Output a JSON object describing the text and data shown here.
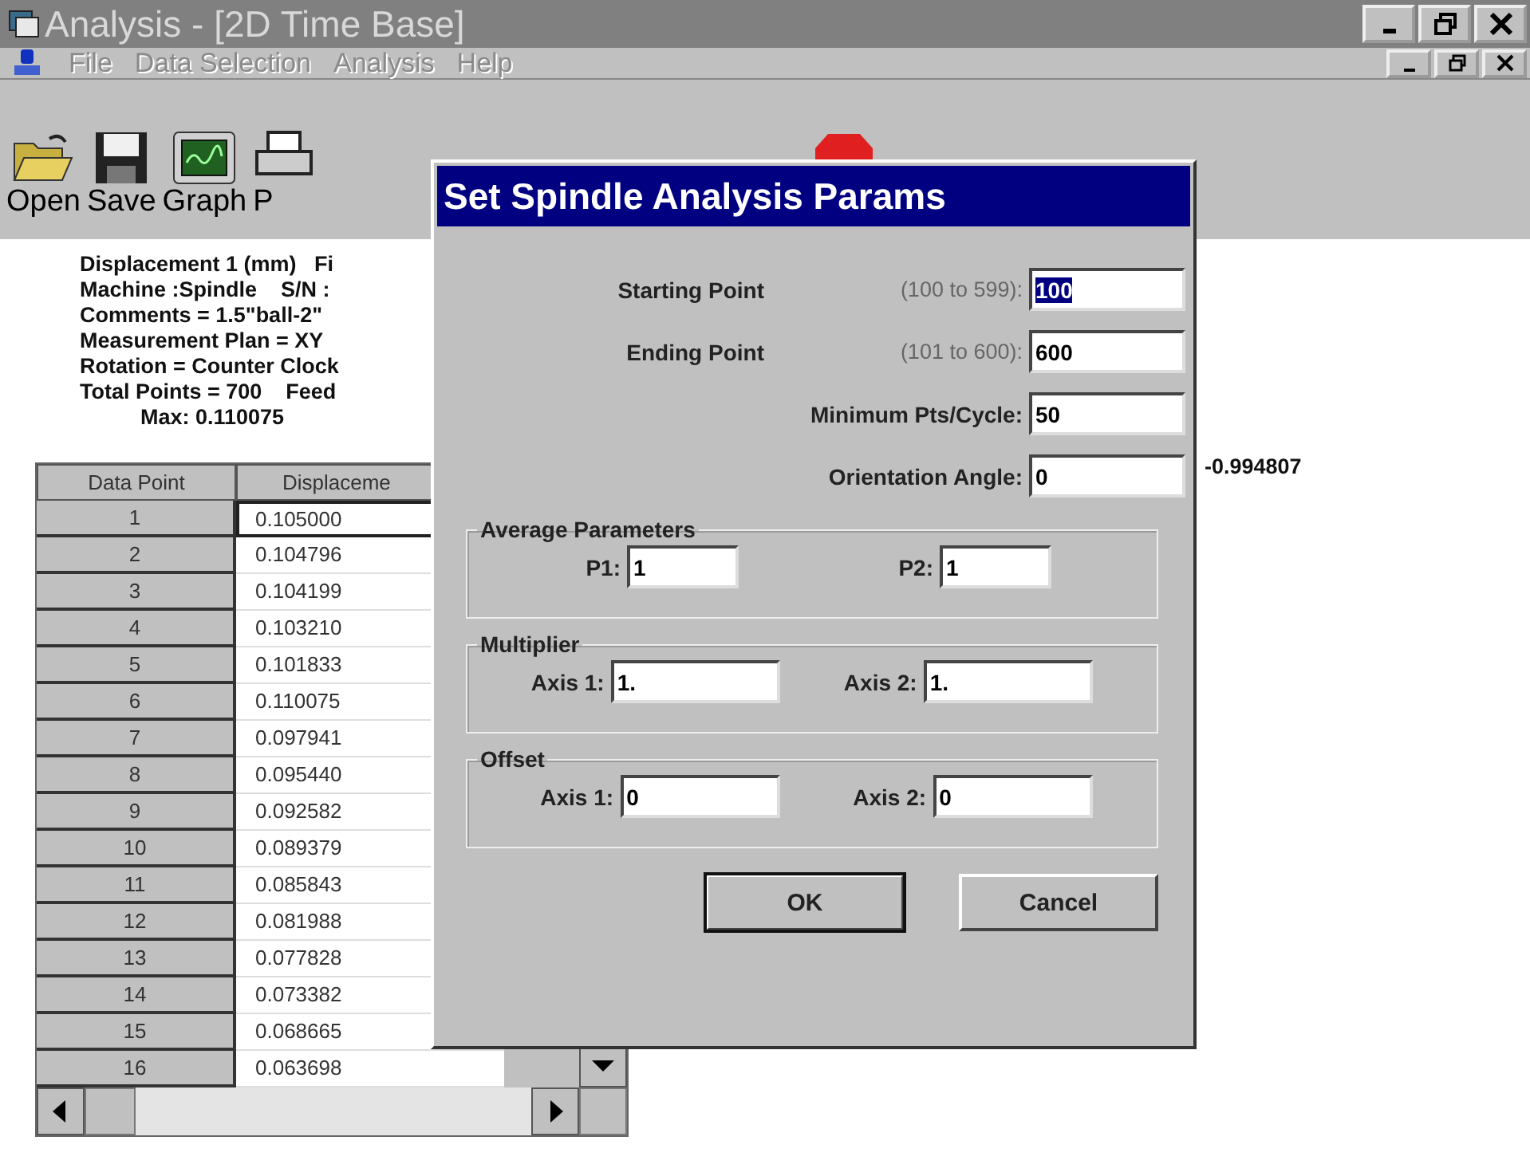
{
  "window": {
    "title": "Analysis - [2D Time Base]"
  },
  "menu": [
    {
      "label": "File",
      "disabled": true
    },
    {
      "label": "Data Selection",
      "disabled": true
    },
    {
      "label": "Analysis",
      "disabled": true
    },
    {
      "label": "Help",
      "disabled": true
    }
  ],
  "toolbar": [
    {
      "label": "Open"
    },
    {
      "label": "Save"
    },
    {
      "label": "Graph"
    },
    {
      "label": "P"
    }
  ],
  "info": [
    {
      "kind": "line",
      "text": "Displacement 1 (mm)   Fi"
    },
    {
      "kind": "line",
      "text": "Machine :Spindle    S/N :"
    },
    {
      "kind": "line",
      "text": "Comments = 1.5\"ball-2\""
    },
    {
      "kind": "line",
      "text": "Measurement Plan = XY"
    },
    {
      "kind": "line",
      "text": "Rotation = Counter Clock"
    },
    {
      "kind": "line",
      "text": "Total Points = 700    Feed"
    },
    {
      "kind": "summary",
      "text": "Max: 0.110075"
    }
  ],
  "side_value": "-0.994807",
  "table": {
    "columns": [
      "Data Point",
      "Displaceme"
    ],
    "rows": [
      {
        "point": "1",
        "value": "0.105000",
        "selected": true
      },
      {
        "point": "2",
        "value": "0.104796",
        "selected": false
      },
      {
        "point": "3",
        "value": "0.104199",
        "selected": false
      },
      {
        "point": "4",
        "value": "0.103210",
        "selected": false
      },
      {
        "point": "5",
        "value": "0.101833",
        "selected": false
      },
      {
        "point": "6",
        "value": "0.110075",
        "selected": false
      },
      {
        "point": "7",
        "value": "0.097941",
        "selected": false
      },
      {
        "point": "8",
        "value": "0.095440",
        "selected": false
      },
      {
        "point": "9",
        "value": "0.092582",
        "selected": false
      },
      {
        "point": "10",
        "value": "0.089379",
        "selected": false
      },
      {
        "point": "11",
        "value": "0.085843",
        "selected": false
      },
      {
        "point": "12",
        "value": "0.081988",
        "selected": false
      },
      {
        "point": "13",
        "value": "0.077828",
        "selected": false
      },
      {
        "point": "14",
        "value": "0.073382",
        "selected": false
      },
      {
        "point": "15",
        "value": "0.068665",
        "selected": false
      },
      {
        "point": "16",
        "value": "0.063698",
        "selected": false
      }
    ]
  },
  "dialog": {
    "title": "Set Spindle Analysis Params",
    "fields": [
      {
        "label": "Starting Point",
        "hint": "(100 to 599):",
        "value": "100",
        "selected": true
      },
      {
        "label": "Ending Point",
        "hint": "(101 to 600):",
        "value": "600",
        "selected": false
      },
      {
        "label": "Minimum Pts/Cycle:",
        "value": "50",
        "selected": false
      },
      {
        "label": "Orientation Angle:",
        "value": "0",
        "selected": false
      }
    ],
    "groups": [
      {
        "title": "Average Parameters",
        "fields": [
          {
            "label": "P1:",
            "value": "1"
          },
          {
            "label": "P2:",
            "value": "1"
          }
        ]
      },
      {
        "title": "Multiplier",
        "fields": [
          {
            "label": "Axis 1:",
            "value": "1."
          },
          {
            "label": "Axis 2:",
            "value": "1."
          }
        ]
      },
      {
        "title": "Offset",
        "fields": [
          {
            "label": "Axis 1:",
            "value": "0"
          },
          {
            "label": "Axis 2:",
            "value": "0"
          }
        ]
      }
    ],
    "buttons": [
      {
        "label": "OK",
        "default": true
      },
      {
        "label": "Cancel",
        "default": false
      }
    ]
  }
}
